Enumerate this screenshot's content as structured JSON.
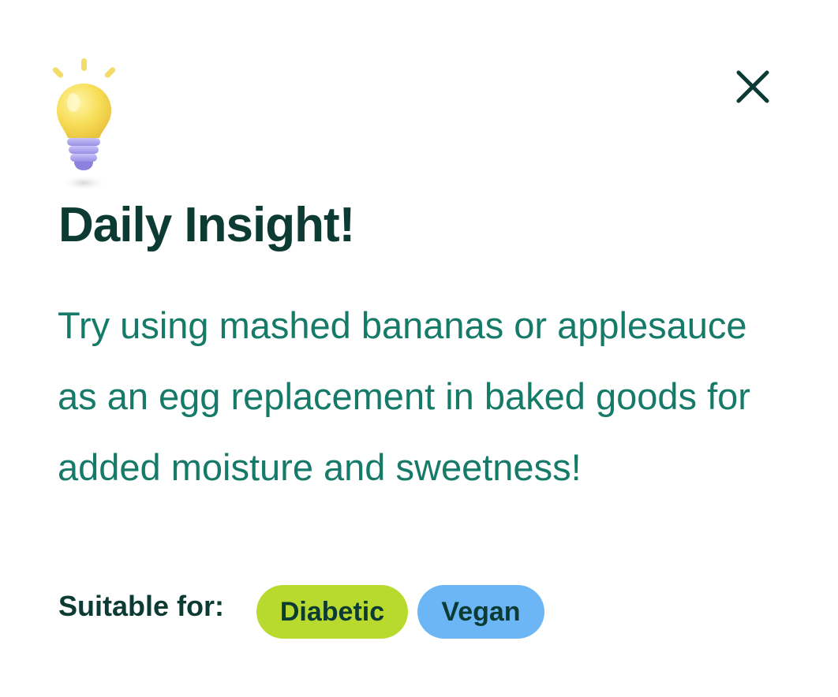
{
  "insight": {
    "icon": "lightbulb-icon",
    "title": "Daily Insight!",
    "body": "Try using mashed bananas or applesauce as an egg replacement in baked goods for added moisture and sweetness!",
    "suitable_label": "Suitable for:",
    "tags": [
      {
        "label": "Diabetic",
        "color": "#b8d92e"
      },
      {
        "label": "Vegan",
        "color": "#6cb6f5"
      }
    ]
  },
  "close": {
    "icon": "close-icon"
  },
  "colors": {
    "heading": "#0c3b33",
    "body_text": "#167a68",
    "background": "#ffffff"
  }
}
